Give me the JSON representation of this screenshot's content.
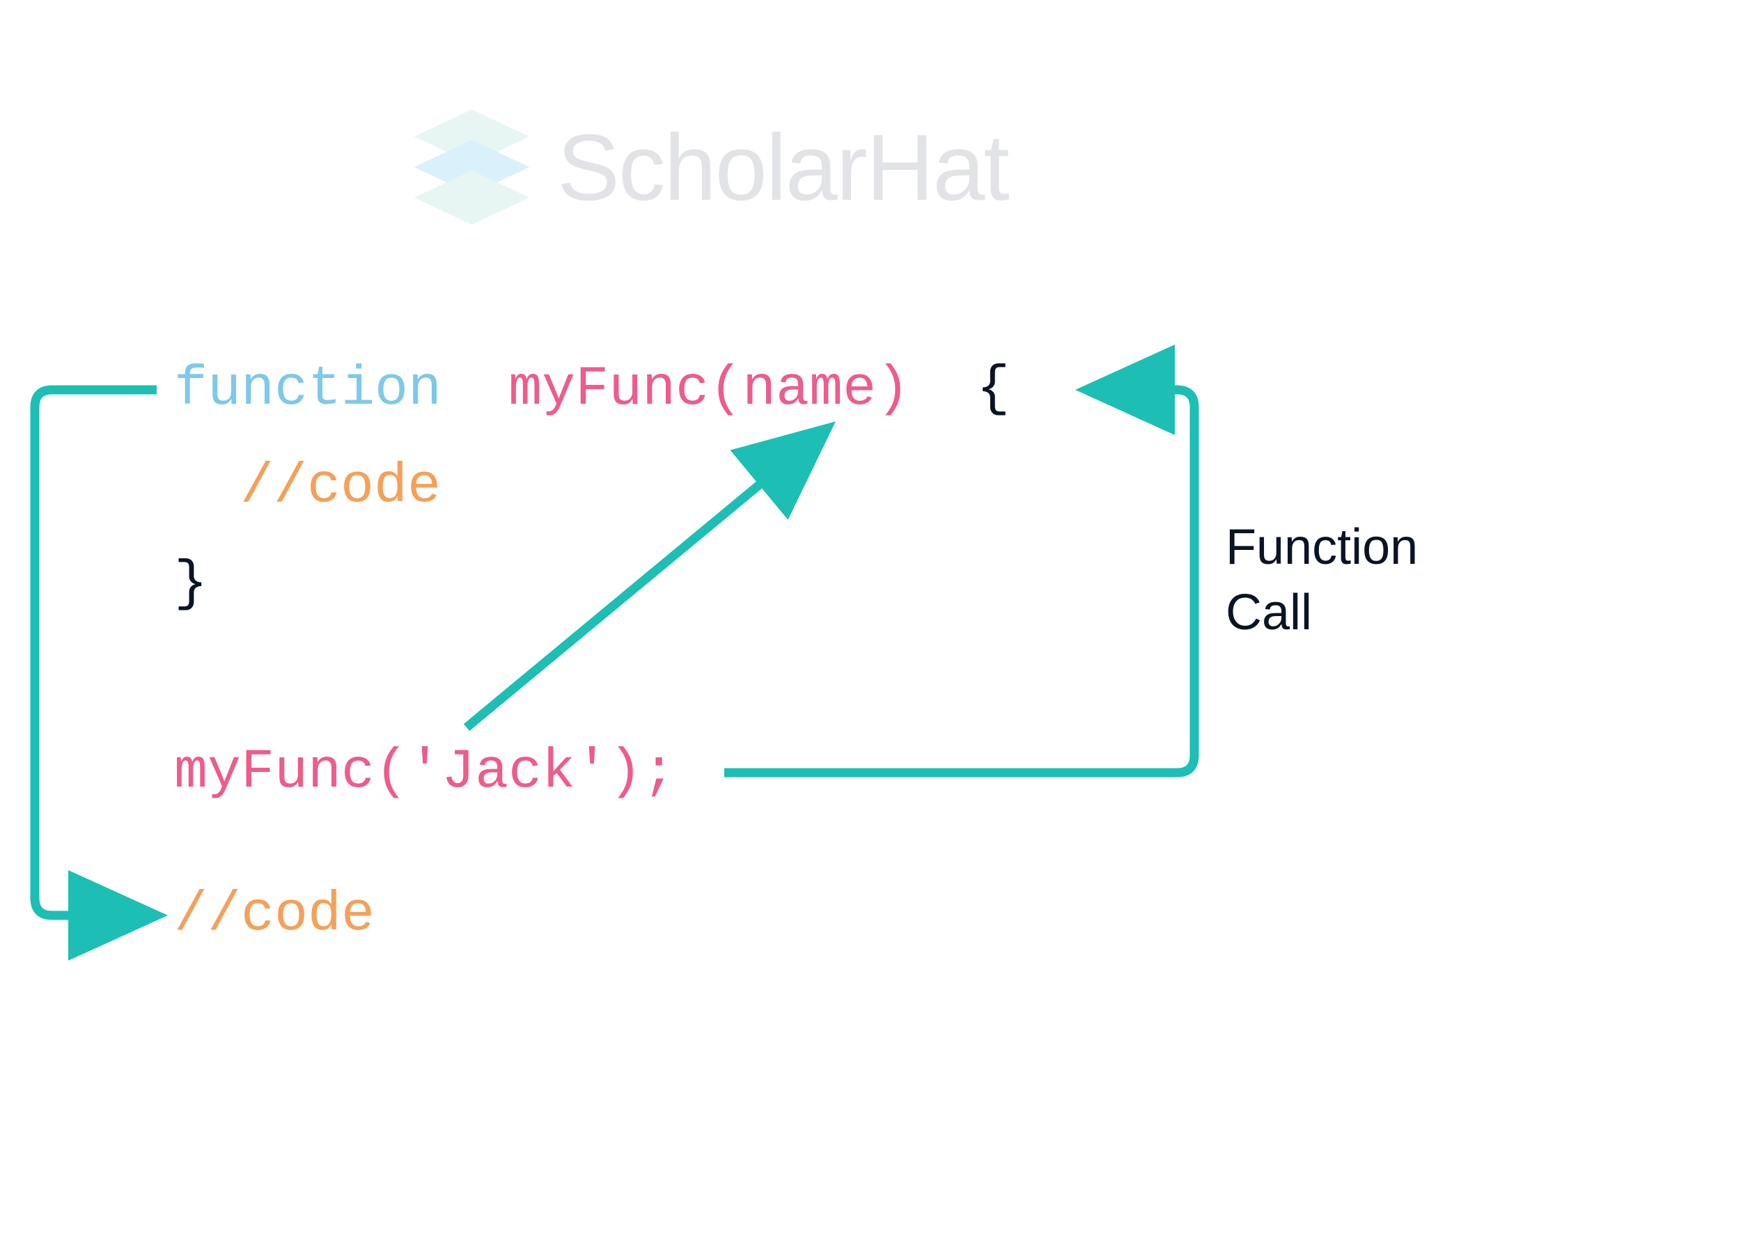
{
  "logo": {
    "text": "ScholarHat"
  },
  "code": {
    "line1_kw": "function ",
    "line1_fn": " myFunc(name) ",
    "line1_br": " {",
    "line2_cm": "//code",
    "line3_br": "}",
    "line4_fn": "myFunc('Jack');",
    "line5_cm": "//code"
  },
  "label": {
    "line1": "Function",
    "line2": "Call"
  },
  "colors": {
    "keyword": "#7ec9e8",
    "function": "#ed5c8a",
    "comment": "#f5a05a",
    "bracket": "#0b1424",
    "arrow": "#1dbfb4",
    "logo_text": "#c9cdd3",
    "logo_light": "#d6f0eb",
    "logo_mid": "#bde4f7"
  }
}
